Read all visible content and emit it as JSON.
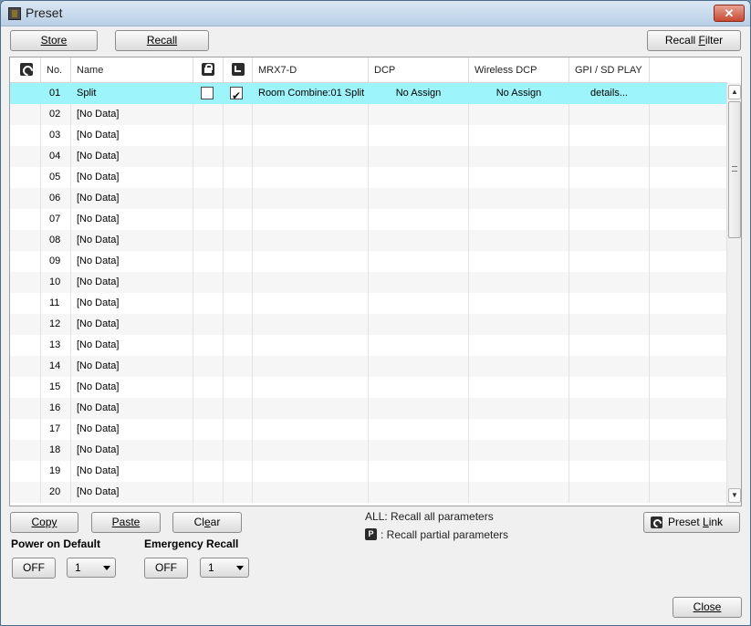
{
  "window": {
    "title": "Preset",
    "close_label": "✕"
  },
  "toolbar": {
    "store": "Store",
    "recall": "Recall",
    "recall_filter_prefix": "Recall ",
    "recall_filter_key": "F",
    "recall_filter_suffix": "ilter"
  },
  "columns": {
    "link_icon": "link-icon",
    "no": "No.",
    "name": "Name",
    "protect_icon": "lock-icon",
    "schedule_icon": "clock-icon",
    "mrx": "MRX7-D",
    "dcp": "DCP",
    "wireless": "Wireless DCP",
    "gpi": "GPI / SD PLAY"
  },
  "rows": [
    {
      "no": "01",
      "name": "Split",
      "protect": false,
      "schedule": true,
      "mrx": "Room Combine:01 Split",
      "dcp": "No Assign",
      "wireless": "No Assign",
      "gpi": "details...",
      "selected": true
    },
    {
      "no": "02",
      "name": "[No Data]"
    },
    {
      "no": "03",
      "name": "[No Data]"
    },
    {
      "no": "04",
      "name": "[No Data]"
    },
    {
      "no": "05",
      "name": "[No Data]"
    },
    {
      "no": "06",
      "name": "[No Data]"
    },
    {
      "no": "07",
      "name": "[No Data]"
    },
    {
      "no": "08",
      "name": "[No Data]"
    },
    {
      "no": "09",
      "name": "[No Data]"
    },
    {
      "no": "10",
      "name": "[No Data]"
    },
    {
      "no": "11",
      "name": "[No Data]"
    },
    {
      "no": "12",
      "name": "[No Data]"
    },
    {
      "no": "13",
      "name": "[No Data]"
    },
    {
      "no": "14",
      "name": "[No Data]"
    },
    {
      "no": "15",
      "name": "[No Data]"
    },
    {
      "no": "16",
      "name": "[No Data]"
    },
    {
      "no": "17",
      "name": "[No Data]"
    },
    {
      "no": "18",
      "name": "[No Data]"
    },
    {
      "no": "19",
      "name": "[No Data]"
    },
    {
      "no": "20",
      "name": "[No Data]"
    }
  ],
  "bottom": {
    "copy": "Copy",
    "paste": "Paste",
    "clear_prefix": "Cl",
    "clear_key": "e",
    "clear_suffix": "ar",
    "legend_all": "ALL: Recall all parameters",
    "legend_partial_badge": "P",
    "legend_partial": ": Recall partial parameters",
    "preset_link_prefix": "Preset ",
    "preset_link_key": "L",
    "preset_link_suffix": "ink",
    "power_on_default_label": "Power on Default",
    "power_off": "OFF",
    "power_value": "1",
    "emergency_label": "Emergency Recall",
    "emergency_off": "OFF",
    "emergency_value": "1",
    "close": "Close"
  },
  "colors": {
    "selected_row": "#9ef4fb",
    "close_button": "#c74a32"
  }
}
